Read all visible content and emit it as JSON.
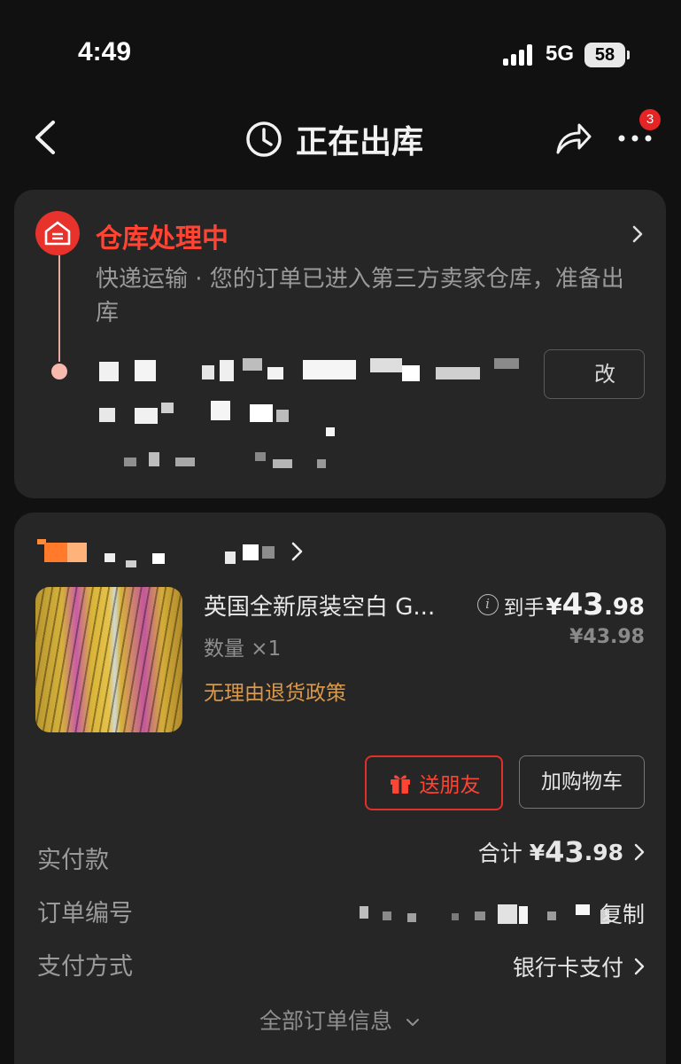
{
  "status_bar": {
    "time": "4:49",
    "network": "5G",
    "battery": "58"
  },
  "nav": {
    "title": "正在出库"
  },
  "notification_badge": "3",
  "shipping": {
    "status_title": "仓库处理中",
    "status_desc": "快递运输 · 您的订单已进入第三方卖家仓库，准备出库",
    "modify_button": "改"
  },
  "product": {
    "title": "英国全新原装空白 G...",
    "quantity": "数量 ×1",
    "policy": "无理由退货政策",
    "price_label": "到手",
    "price_symbol": "¥",
    "price_int": "43",
    "price_dec": ".98",
    "original_price": "¥43.98"
  },
  "actions": {
    "gift": "送朋友",
    "cart": "加购物车"
  },
  "order_info": {
    "paid_label": "实付款",
    "paid_value_prefix": "合计",
    "paid_symbol": "¥",
    "paid_int": "43",
    "paid_dec": ".98",
    "order_no_label": "订单编号",
    "copy_label": "复制",
    "payment_label": "支付方式",
    "payment_value": "银行卡支付",
    "all_info": "全部订单信息"
  },
  "colors": {
    "accent_red": "#e8322c",
    "policy_orange": "#d9984a",
    "card_bg": "#262626",
    "page_bg": "#111111"
  }
}
